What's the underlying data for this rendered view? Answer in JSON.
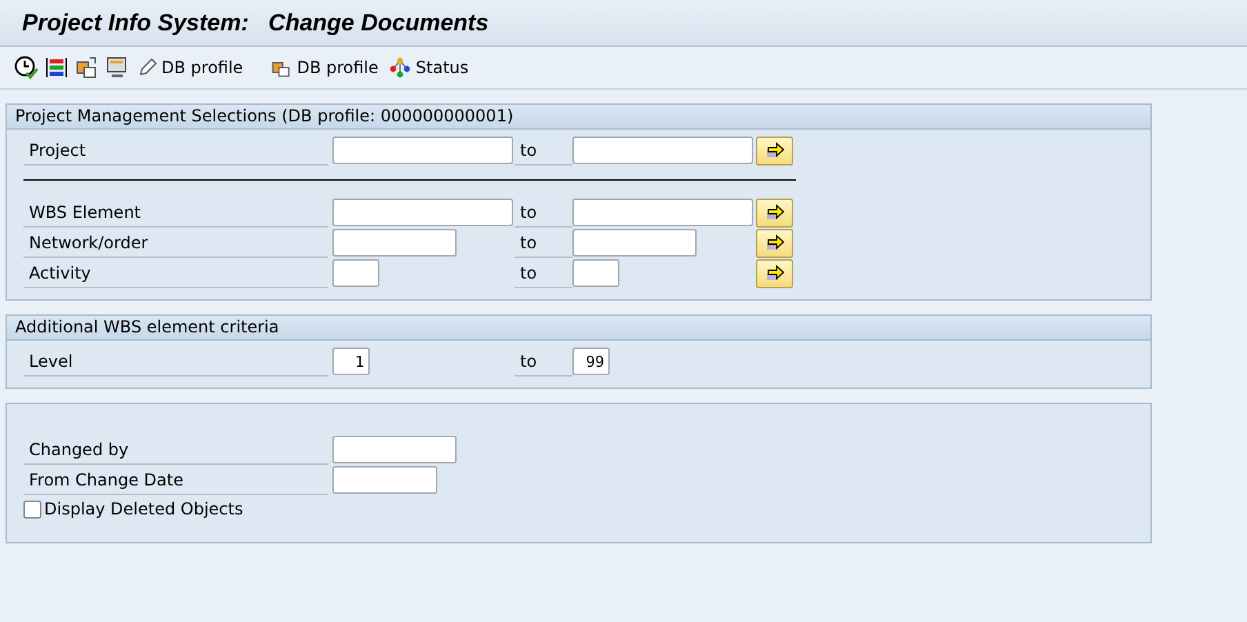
{
  "window": {
    "title": "Project Info System:   Change Documents"
  },
  "toolbar": {
    "buttons": [
      {
        "label": "DB profile"
      },
      {
        "label": "DB profile"
      },
      {
        "label": "Status"
      }
    ]
  },
  "sections": [
    {
      "title": "Project Management Selections (DB profile: 000000000001)",
      "rows": [
        {
          "kind": "range",
          "label": "Project",
          "low": "",
          "high": "",
          "to": "to",
          "multiple_selection": true
        },
        {
          "kind": "separator"
        },
        {
          "kind": "range",
          "label": "WBS Element",
          "low": "",
          "high": "",
          "to": "to",
          "multiple_selection": true
        },
        {
          "kind": "range",
          "label": "Network/order",
          "low": "",
          "high": "",
          "to": "to",
          "multiple_selection": true
        },
        {
          "kind": "range",
          "label": "Activity",
          "low": "",
          "high": "",
          "to": "to",
          "multiple_selection": true
        }
      ]
    },
    {
      "title": "Additional WBS element criteria",
      "rows": [
        {
          "kind": "range",
          "label": "Level",
          "low": "1",
          "high": "99",
          "to": "to",
          "multiple_selection": false
        }
      ]
    },
    {
      "rows": [
        {
          "kind": "field",
          "label": "Changed by",
          "value": ""
        },
        {
          "kind": "field",
          "label": "From Change Date",
          "value": ""
        },
        {
          "kind": "checkbox",
          "label": "Display Deleted Objects",
          "checked": false
        }
      ]
    }
  ]
}
